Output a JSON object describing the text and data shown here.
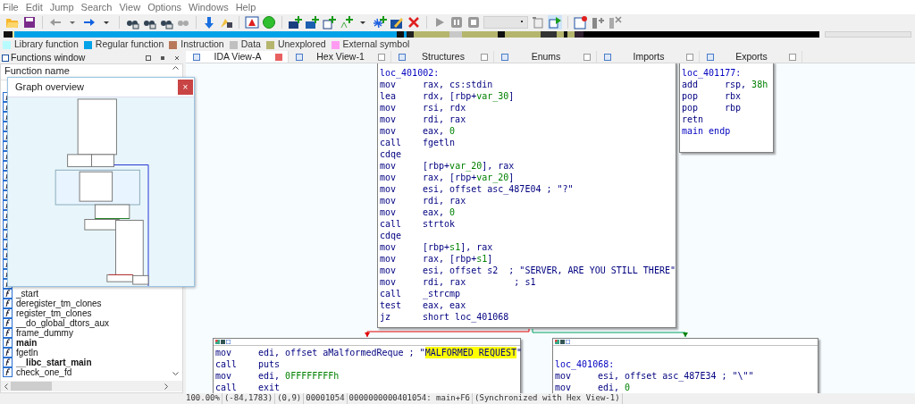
{
  "menu": [
    "File",
    "Edit",
    "Jump",
    "Search",
    "View",
    "Options",
    "Windows",
    "Help"
  ],
  "legend": [
    {
      "label": "Library function",
      "color": "#b8fbff"
    },
    {
      "label": "Regular function",
      "color": "#00a2e8"
    },
    {
      "label": "Instruction",
      "color": "#b8785a"
    },
    {
      "label": "Data",
      "color": "#c0c0c0"
    },
    {
      "label": "Unexplored",
      "color": "#b5b56e"
    },
    {
      "label": "External symbol",
      "color": "#ff9cf2"
    }
  ],
  "functions_window": {
    "title": "Functions window",
    "column": "Function name",
    "items": [
      {
        "name": "_start",
        "bold": false
      },
      {
        "name": "deregister_tm_clones",
        "bold": false
      },
      {
        "name": "register_tm_clones",
        "bold": false
      },
      {
        "name": "__do_global_dtors_aux",
        "bold": false
      },
      {
        "name": "frame_dummy",
        "bold": false
      },
      {
        "name": "main",
        "bold": true
      },
      {
        "name": "fgetln",
        "bold": false
      },
      {
        "name": "__libc_start_main",
        "bold": true
      },
      {
        "name": "check_one_fd",
        "bold": false
      }
    ]
  },
  "graph_overview": {
    "title": "Graph overview",
    "close": "×"
  },
  "tabs": [
    {
      "label": "IDA View-A",
      "selected": true
    },
    {
      "label": "Hex View-1",
      "selected": false
    },
    {
      "label": "Structures",
      "selected": false
    },
    {
      "label": "Enums",
      "selected": false
    },
    {
      "label": "Imports",
      "selected": false
    },
    {
      "label": "Exports",
      "selected": false
    }
  ],
  "nodes": [
    {
      "toolbar": false,
      "lines": [
        {
          "kind": "label",
          "text": "loc_401002:"
        },
        {
          "kind": "instr",
          "op": "mov",
          "parts": [
            {
              "kind": "name",
              "text": "rax, cs:stdin"
            }
          ]
        },
        {
          "kind": "instr",
          "op": "lea",
          "parts": [
            {
              "kind": "name",
              "text": "rdx, [rbp+"
            },
            {
              "kind": "num",
              "text": "var_30"
            },
            {
              "kind": "name",
              "text": "]"
            }
          ]
        },
        {
          "kind": "instr",
          "op": "mov",
          "parts": [
            {
              "kind": "name",
              "text": "rsi, rdx"
            }
          ]
        },
        {
          "kind": "instr",
          "op": "mov",
          "parts": [
            {
              "kind": "name",
              "text": "rdi, rax"
            }
          ]
        },
        {
          "kind": "instr",
          "op": "mov",
          "parts": [
            {
              "kind": "name",
              "text": "eax, "
            },
            {
              "kind": "num",
              "text": "0"
            }
          ]
        },
        {
          "kind": "instr",
          "op": "call",
          "parts": [
            {
              "kind": "name",
              "text": "fgetln"
            }
          ]
        },
        {
          "kind": "instr",
          "op": "cdqe"
        },
        {
          "kind": "instr",
          "op": "mov",
          "parts": [
            {
              "kind": "name",
              "text": "[rbp+"
            },
            {
              "kind": "num",
              "text": "var_20"
            },
            {
              "kind": "name",
              "text": "], rax"
            }
          ]
        },
        {
          "kind": "instr",
          "op": "mov",
          "parts": [
            {
              "kind": "name",
              "text": "rax, [rbp+"
            },
            {
              "kind": "num",
              "text": "var_20"
            },
            {
              "kind": "name",
              "text": "]"
            }
          ]
        },
        {
          "kind": "instr",
          "op": "mov",
          "parts": [
            {
              "kind": "name",
              "text": "esi, offset asc_487E04 ; \"?\""
            }
          ]
        },
        {
          "kind": "instr",
          "op": "mov",
          "parts": [
            {
              "kind": "name",
              "text": "rdi, rax"
            }
          ]
        },
        {
          "kind": "instr",
          "op": "mov",
          "parts": [
            {
              "kind": "name",
              "text": "eax, "
            },
            {
              "kind": "num",
              "text": "0"
            }
          ]
        },
        {
          "kind": "instr",
          "op": "call",
          "parts": [
            {
              "kind": "name",
              "text": "strtok"
            }
          ]
        },
        {
          "kind": "instr",
          "op": "cdqe"
        },
        {
          "kind": "instr",
          "op": "mov",
          "parts": [
            {
              "kind": "name",
              "text": "[rbp+"
            },
            {
              "kind": "num",
              "text": "s1"
            },
            {
              "kind": "name",
              "text": "], rax"
            }
          ]
        },
        {
          "kind": "instr",
          "op": "mov",
          "parts": [
            {
              "kind": "name",
              "text": "rax, [rbp+"
            },
            {
              "kind": "num",
              "text": "s1"
            },
            {
              "kind": "name",
              "text": "]"
            }
          ]
        },
        {
          "kind": "instr",
          "op": "mov",
          "parts": [
            {
              "kind": "name",
              "text": "esi, offset s2  ; \"SERVER, ARE YOU STILL THERE\""
            }
          ]
        },
        {
          "kind": "instr",
          "op": "mov",
          "parts": [
            {
              "kind": "name",
              "text": "rdi, rax         ; s1"
            }
          ]
        },
        {
          "kind": "instr",
          "op": "call",
          "parts": [
            {
              "kind": "name",
              "text": "_strcmp"
            }
          ]
        },
        {
          "kind": "instr",
          "op": "test",
          "parts": [
            {
              "kind": "name",
              "text": "eax, eax"
            }
          ]
        },
        {
          "kind": "instr",
          "op": "jz",
          "parts": [
            {
              "kind": "name",
              "text": "short loc_401068"
            }
          ]
        }
      ]
    },
    {
      "toolbar": false,
      "lines": [
        {
          "kind": "label",
          "text": "loc_401177:"
        },
        {
          "kind": "instr",
          "op": "add",
          "parts": [
            {
              "kind": "name",
              "text": "rsp, "
            },
            {
              "kind": "num",
              "text": "38h"
            }
          ]
        },
        {
          "kind": "instr",
          "op": "pop",
          "parts": [
            {
              "kind": "name",
              "text": "rbx"
            }
          ]
        },
        {
          "kind": "instr",
          "op": "pop",
          "parts": [
            {
              "kind": "name",
              "text": "rbp"
            }
          ]
        },
        {
          "kind": "instr",
          "op": "retn"
        },
        {
          "kind": "label",
          "text": "main endp"
        }
      ]
    },
    {
      "toolbar": true,
      "lines": [
        {
          "kind": "instr",
          "op": "mov",
          "parts": [
            {
              "kind": "name",
              "text": "edi, offset aMalformedReque ; \""
            },
            {
              "kind": "highlight",
              "text": "MALFORMED REQUEST"
            },
            {
              "kind": "name",
              "text": "\""
            }
          ]
        },
        {
          "kind": "instr",
          "op": "call",
          "parts": [
            {
              "kind": "name",
              "text": "puts"
            }
          ]
        },
        {
          "kind": "instr",
          "op": "mov",
          "parts": [
            {
              "kind": "name",
              "text": "edi, "
            },
            {
              "kind": "num",
              "text": "0FFFFFFFFh"
            }
          ]
        },
        {
          "kind": "instr",
          "op": "call",
          "parts": [
            {
              "kind": "name",
              "text": "exit"
            }
          ]
        }
      ]
    },
    {
      "toolbar": true,
      "lines": [
        {
          "kind": "blank"
        },
        {
          "kind": "label",
          "text": "loc_401068:"
        },
        {
          "kind": "instr",
          "op": "mov",
          "parts": [
            {
              "kind": "name",
              "text": "esi, offset asc_487E34 ; \"\\\"\""
            }
          ]
        },
        {
          "kind": "instr",
          "op": "mov",
          "parts": [
            {
              "kind": "name",
              "text": "edi, "
            },
            {
              "kind": "num",
              "text": "0"
            }
          ]
        }
      ]
    }
  ],
  "status_bar": [
    "100.00%",
    "(-84,1783)",
    "(0,9)",
    "00001054",
    "0000000000401054: main+F6",
    "(Synchronized with Hex View-1)"
  ]
}
